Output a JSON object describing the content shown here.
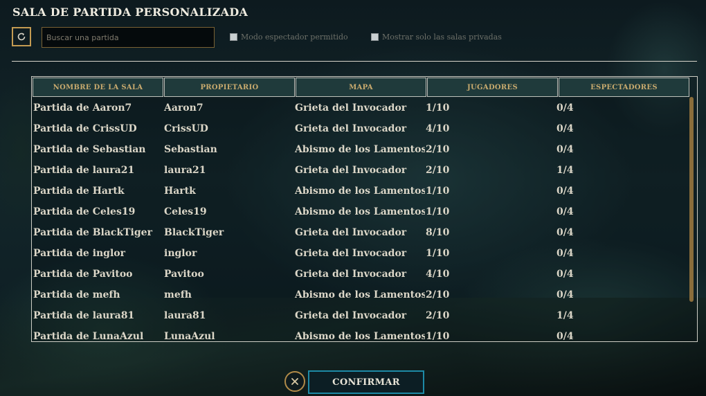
{
  "header": {
    "title": "SALA DE PARTIDA PERSONALIZADA"
  },
  "toolbar": {
    "refresh_icon": "refresh-icon",
    "search_placeholder": "Buscar una partida",
    "search_value": "",
    "spectator_label": "Modo espectador permitido",
    "spectator_checked": false,
    "private_label": "Mostrar solo las salas privadas",
    "private_checked": false
  },
  "table": {
    "columns": [
      "NOMBRE DE LA SALA",
      "PROPIETARIO",
      "MAPA",
      "JUGADORES",
      "ESPECTADORES"
    ],
    "rows": [
      [
        "Partida de Aaron7",
        "Aaron7",
        "Grieta del Invocador",
        "1/10",
        "0/4"
      ],
      [
        "Partida de CrissUD",
        "CrissUD",
        "Grieta del Invocador",
        "4/10",
        "0/4"
      ],
      [
        "Partida de Sebastian",
        "Sebastian",
        "Abismo de los Lamentos",
        "2/10",
        "0/4"
      ],
      [
        "Partida de laura21",
        "laura21",
        "Grieta del Invocador",
        "2/10",
        "1/4"
      ],
      [
        "Partida de Hartk",
        "Hartk",
        "Abismo de los Lamentos",
        "1/10",
        "0/4"
      ],
      [
        "Partida de Celes19",
        "Celes19",
        "Abismo de los Lamentos",
        "1/10",
        "0/4"
      ],
      [
        "Partida de BlackTiger",
        "BlackTiger",
        "Grieta del Invocador",
        "8/10",
        "0/4"
      ],
      [
        "Partida de inglor",
        "inglor",
        "Grieta del Invocador",
        "1/10",
        "0/4"
      ],
      [
        "Partida de Pavitoo",
        "Pavitoo",
        "Grieta del Invocador",
        "4/10",
        "0/4"
      ],
      [
        "Partida de mefh",
        "mefh",
        "Abismo de los Lamentos",
        "2/10",
        "0/4"
      ],
      [
        "Partida de laura81",
        "laura81",
        "Grieta del Invocador",
        "2/10",
        "1/4"
      ],
      [
        "Partida de LunaAzul",
        "LunaAzul",
        "Abismo de los Lamentos",
        "1/10",
        "0/4"
      ]
    ]
  },
  "footer": {
    "close_icon": "close-icon",
    "confirm_label": "CONFIRMAR"
  },
  "colors": {
    "accent_gold": "#c8aa6e",
    "accent_blue": "#1d8aa6",
    "header_bg": "#1f3a3b"
  }
}
